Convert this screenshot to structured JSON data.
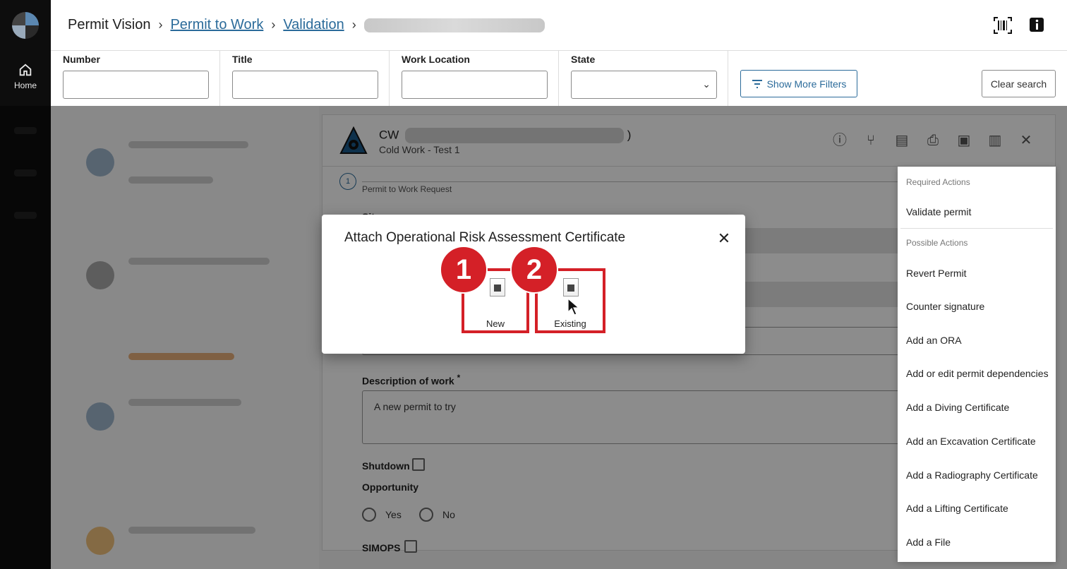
{
  "rail": {
    "home_label": "Home"
  },
  "breadcrumb": {
    "root": "Permit Vision",
    "link1": "Permit to Work",
    "link2": "Validation",
    "separator": "›"
  },
  "filters": {
    "number_label": "Number",
    "title_label": "Title",
    "location_label": "Work Location",
    "state_label": "State",
    "more_filters": "Show More Filters",
    "clear_search": "Clear search"
  },
  "permit": {
    "title_prefix": "CW",
    "title_suffix": ")",
    "subtitle": "Cold Work - Test 1",
    "step_number": "1",
    "step_label": "Permit to Work Request",
    "site_label": "Site",
    "description_label": "Description of work",
    "required_mark": "*",
    "description_value": "A new permit to try",
    "shutdown_label": "Shutdown",
    "opportunity_label": "Opportunity",
    "yes_label": "Yes",
    "no_label": "No",
    "simops_label": "SIMOPS"
  },
  "menu": {
    "required_section": "Required Actions",
    "required_items": [
      "Validate permit"
    ],
    "possible_section": "Possible Actions",
    "possible_items": [
      "Revert Permit",
      "Counter signature",
      "Add an ORA",
      "Add or edit permit dependencies",
      "Add a Diving Certificate",
      "Add an Excavation Certificate",
      "Add a Radiography Certificate",
      "Add a Lifting Certificate",
      "Add a File"
    ]
  },
  "modal": {
    "title": "Attach Operational Risk Assessment Certificate",
    "close": "✕",
    "option_new": "New",
    "option_existing": "Existing",
    "badge1": "1",
    "badge2": "2"
  },
  "colors": {
    "accent": "#2b6b9a",
    "highlight": "#d42027"
  }
}
